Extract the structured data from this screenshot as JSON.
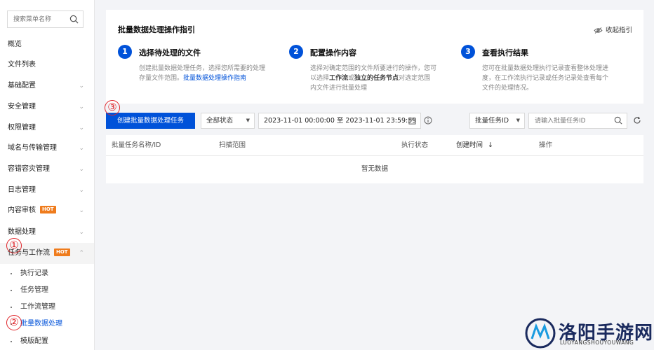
{
  "sidebar": {
    "search_placeholder": "搜索菜单名称",
    "items": [
      {
        "label": "概览",
        "has_chevron": false
      },
      {
        "label": "文件列表",
        "has_chevron": false
      },
      {
        "label": "基础配置",
        "has_chevron": true
      },
      {
        "label": "安全管理",
        "has_chevron": true
      },
      {
        "label": "权限管理",
        "has_chevron": true
      },
      {
        "label": "域名与传输管理",
        "has_chevron": true
      },
      {
        "label": "容错容灾管理",
        "has_chevron": true
      },
      {
        "label": "日志管理",
        "has_chevron": true
      },
      {
        "label": "内容审核",
        "has_chevron": true,
        "badge": "HOT"
      },
      {
        "label": "数据处理",
        "has_chevron": true
      },
      {
        "label": "任务与工作流",
        "has_chevron": true,
        "badge": "HOT",
        "expanded": true
      }
    ],
    "sub_items": [
      {
        "label": "执行记录"
      },
      {
        "label": "任务管理"
      },
      {
        "label": "工作流管理"
      },
      {
        "label": "批量数据处理",
        "active": true
      },
      {
        "label": "模版配置"
      }
    ]
  },
  "annotations": [
    "①",
    "②",
    "③"
  ],
  "guide": {
    "title": "批量数据处理操作指引",
    "collapse_label": "收起指引",
    "steps": [
      {
        "num": "1",
        "title": "选择待处理的文件",
        "desc_before": "创建批量数据处理任务，选择您所需要的处理存量文件范围。",
        "link": "批量数据处理操作指南"
      },
      {
        "num": "2",
        "title": "配置操作内容",
        "desc_a": "选择对确定范围的文件所要进行的操作，您可以选择",
        "bold_a": "工作流",
        "desc_b": "或",
        "bold_b": "独立的任务节点",
        "desc_c": "对选定范围内文件进行批量处理"
      },
      {
        "num": "3",
        "title": "查看执行结果",
        "desc": "您可在批量数据处理执行记录查看整体处理进度，在工作流执行记录或任务记录处查看每个文件的处理情况。"
      }
    ]
  },
  "toolbar": {
    "create_button": "创建批量数据处理任务",
    "status_select": "全部状态",
    "date_range": "2023-11-01 00:00:00 至 2023-11-01 23:59:59",
    "id_select": "批量任务ID",
    "id_placeholder": "请输入批量任务ID"
  },
  "table": {
    "columns": [
      "批量任务名称/ID",
      "扫描范围",
      "执行状态",
      "创建时间",
      "操作"
    ],
    "sort_indicator": "↓",
    "empty_text": "暂无数据"
  },
  "watermark": {
    "title": "洛阳手游网",
    "subtitle": "LUOYANGSHOUYOUWANG"
  },
  "colors": {
    "primary": "#0052d9",
    "hot_badge": "#ef7c1d",
    "annotation": "#e0262b"
  }
}
